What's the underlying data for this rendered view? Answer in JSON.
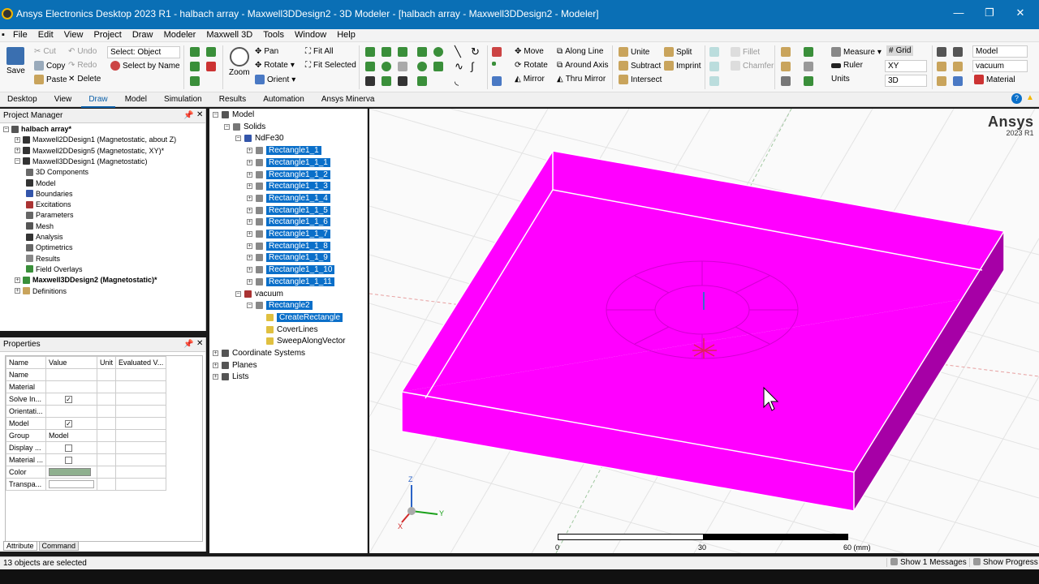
{
  "window": {
    "title": "Ansys Electronics Desktop 2023 R1 - halbach array - Maxwell3DDesign2 - 3D Modeler - [halbach array - Maxwell3DDesign2 - Modeler]",
    "minimize": "—",
    "restore": "❐",
    "close": "✕"
  },
  "menu": [
    "File",
    "Edit",
    "View",
    "Project",
    "Draw",
    "Modeler",
    "Maxwell 3D",
    "Tools",
    "Window",
    "Help"
  ],
  "ribbon": {
    "save": "Save",
    "cut": "Cut",
    "copy": "Copy",
    "paste": "Paste",
    "undo": "Undo",
    "redo": "Redo",
    "delete": "Delete",
    "select_dropdown": "Select: Object",
    "select_by_name": "Select by Name",
    "zoom": "Zoom",
    "pan": "Pan",
    "rotate": "Rotate",
    "orient": "Orient",
    "fit_all": "Fit All",
    "fit_selected": "Fit Selected",
    "move": "Move",
    "rotate2": "Rotate",
    "mirror": "Mirror",
    "along_line": "Along Line",
    "around_axis": "Around Axis",
    "thru_mirror": "Thru Mirror",
    "unite": "Unite",
    "subtract": "Subtract",
    "intersect": "Intersect",
    "split": "Split",
    "imprint": "Imprint",
    "fillet": "Fillet",
    "chamfer": "Chamfer",
    "measure": "Measure",
    "ruler": "Ruler",
    "units": "Units",
    "grid": "Grid",
    "plane": "XY",
    "view_mode": "3D",
    "model_dropdown": "Model",
    "material_dropdown": "vacuum",
    "material": "Material"
  },
  "tabs": [
    "Desktop",
    "View",
    "Draw",
    "Model",
    "Simulation",
    "Results",
    "Automation",
    "Ansys Minerva"
  ],
  "active_tab": "Draw",
  "project_manager": {
    "title": "Project Manager",
    "items": [
      {
        "label": "halbach array*",
        "level": 0
      },
      {
        "label": "Maxwell2DDesign1 (Magnetostatic, about Z)",
        "level": 1
      },
      {
        "label": "Maxwell2DDesign5 (Magnetostatic, XY)*",
        "level": 1
      },
      {
        "label": "Maxwell3DDesign1 (Magnetostatic)",
        "level": 1
      },
      {
        "label": "3D Components",
        "level": 2
      },
      {
        "label": "Model",
        "level": 2
      },
      {
        "label": "Boundaries",
        "level": 2
      },
      {
        "label": "Excitations",
        "level": 2
      },
      {
        "label": "Parameters",
        "level": 2
      },
      {
        "label": "Mesh",
        "level": 2
      },
      {
        "label": "Analysis",
        "level": 2
      },
      {
        "label": "Optimetrics",
        "level": 2
      },
      {
        "label": "Results",
        "level": 2
      },
      {
        "label": "Field Overlays",
        "level": 2
      },
      {
        "label": "Maxwell3DDesign2 (Magnetostatic)*",
        "level": 1
      },
      {
        "label": "Definitions",
        "level": 1
      }
    ]
  },
  "properties": {
    "title": "Properties",
    "headers": [
      "Name",
      "Value",
      "Unit",
      "Evaluated V..."
    ],
    "rows": [
      {
        "name": "Name",
        "value": ""
      },
      {
        "name": "Material",
        "value": ""
      },
      {
        "name": "Solve In...",
        "value": "✓"
      },
      {
        "name": "Orientati...",
        "value": ""
      },
      {
        "name": "Model",
        "value": "✓"
      },
      {
        "name": "Group",
        "value": "Model"
      },
      {
        "name": "Display ...",
        "value": ""
      },
      {
        "name": "Material ...",
        "value": ""
      },
      {
        "name": "Color",
        "value": ""
      },
      {
        "name": "Transpa...",
        "value": ""
      }
    ],
    "color_swatch": "#8fb08f",
    "tabs": [
      "Attribute",
      "Command"
    ]
  },
  "model_tree": {
    "root": "Model",
    "solids": "Solids",
    "material1": "NdFe30",
    "rectangles": [
      "Rectangle1_1",
      "Rectangle1_1_1",
      "Rectangle1_1_2",
      "Rectangle1_1_3",
      "Rectangle1_1_4",
      "Rectangle1_1_5",
      "Rectangle1_1_6",
      "Rectangle1_1_7",
      "Rectangle1_1_8",
      "Rectangle1_1_9",
      "Rectangle1_1_10",
      "Rectangle1_1_11"
    ],
    "material2": "vacuum",
    "rect2": "Rectangle2",
    "ops": [
      "CreateRectangle",
      "CoverLines",
      "SweepAlongVector"
    ],
    "others": [
      "Coordinate Systems",
      "Planes",
      "Lists"
    ]
  },
  "viewport": {
    "brand": "Ansys",
    "version": "2023 R1",
    "box_color": "#ff00ff",
    "scale_labels": [
      "0",
      "30",
      "60 (mm)"
    ],
    "axes": {
      "z": "Z",
      "y": "Y",
      "x": "X"
    }
  },
  "status": {
    "selection": "13 objects are selected",
    "messages": "Show 1 Messages",
    "progress": "Show Progress"
  }
}
